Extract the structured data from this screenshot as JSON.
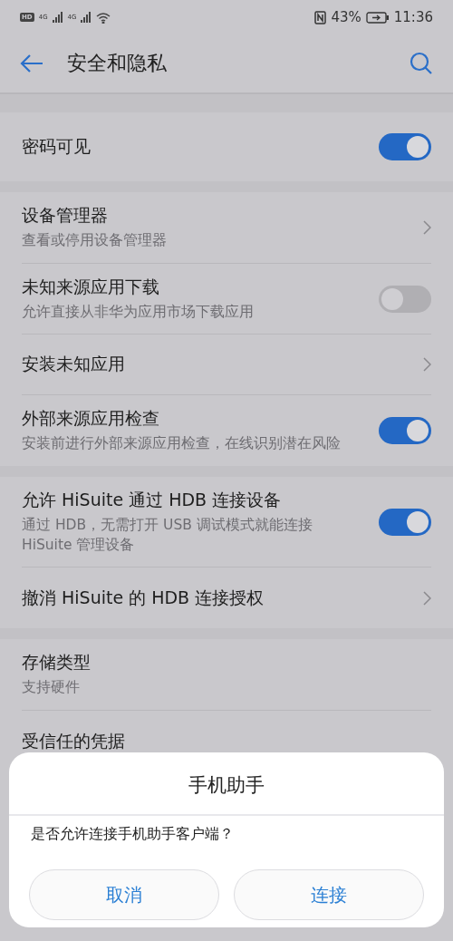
{
  "status_bar": {
    "hd": "HD",
    "signals": [
      "4G",
      "4G"
    ],
    "battery": "43%",
    "time": "11:36"
  },
  "toolbar": {
    "title": "安全和隐私"
  },
  "groups": [
    {
      "items": [
        {
          "kind": "toggle",
          "title": "密码可见",
          "on": true
        }
      ]
    },
    {
      "items": [
        {
          "kind": "chevron",
          "title": "设备管理器",
          "subtitle": "查看或停用设备管理器"
        },
        {
          "kind": "toggle",
          "title": "未知来源应用下载",
          "subtitle": "允许直接从非华为应用市场下载应用",
          "on": false
        },
        {
          "kind": "chevron",
          "title": "安装未知应用"
        },
        {
          "kind": "toggle",
          "title": "外部来源应用检查",
          "subtitle": "安装前进行外部来源应用检查，在线识别潜在风险",
          "on": true
        }
      ]
    },
    {
      "items": [
        {
          "kind": "toggle",
          "title": "允许 HiSuite 通过 HDB 连接设备",
          "subtitle": "通过 HDB，无需打开 USB 调试模式就能连接 HiSuite 管理设备",
          "on": true
        },
        {
          "kind": "chevron",
          "title": "撤消 HiSuite 的 HDB 连接授权"
        }
      ]
    },
    {
      "items": [
        {
          "kind": "plain",
          "title": "存储类型",
          "subtitle": "支持硬件"
        },
        {
          "kind": "plain",
          "title": "受信任的凭据"
        }
      ]
    }
  ],
  "dialog": {
    "title": "手机助手",
    "message": "是否允许连接手机助手客户端？",
    "buttons": [
      "取消",
      "连接"
    ]
  }
}
